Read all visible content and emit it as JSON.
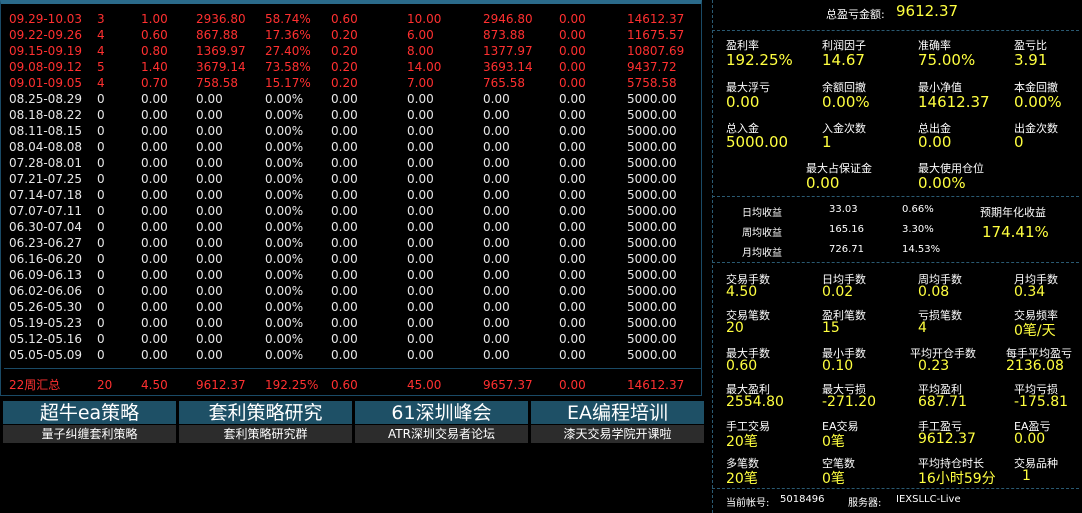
{
  "weekly_table": {
    "rows": [
      {
        "period": "09.29-10.03",
        "c1": "3",
        "c2": "1.00",
        "c3": "2936.80",
        "c4": "58.74%",
        "c5": "0.60",
        "c6": "10.00",
        "c7": "2946.80",
        "c8": "0.00",
        "c9": "14612.37",
        "highlight": true
      },
      {
        "period": "09.22-09.26",
        "c1": "4",
        "c2": "0.60",
        "c3": "867.88",
        "c4": "17.36%",
        "c5": "0.20",
        "c6": "6.00",
        "c7": "873.88",
        "c8": "0.00",
        "c9": "11675.57",
        "highlight": true
      },
      {
        "period": "09.15-09.19",
        "c1": "4",
        "c2": "0.80",
        "c3": "1369.97",
        "c4": "27.40%",
        "c5": "0.20",
        "c6": "8.00",
        "c7": "1377.97",
        "c8": "0.00",
        "c9": "10807.69",
        "highlight": true
      },
      {
        "period": "09.08-09.12",
        "c1": "5",
        "c2": "1.40",
        "c3": "3679.14",
        "c4": "73.58%",
        "c5": "0.20",
        "c6": "14.00",
        "c7": "3693.14",
        "c8": "0.00",
        "c9": "9437.72",
        "highlight": true
      },
      {
        "period": "09.01-09.05",
        "c1": "4",
        "c2": "0.70",
        "c3": "758.58",
        "c4": "15.17%",
        "c5": "0.20",
        "c6": "7.00",
        "c7": "765.58",
        "c8": "0.00",
        "c9": "5758.58",
        "highlight": true
      },
      {
        "period": "08.25-08.29",
        "c1": "0",
        "c2": "0.00",
        "c3": "0.00",
        "c4": "0.00%",
        "c5": "0.00",
        "c6": "0.00",
        "c7": "0.00",
        "c8": "0.00",
        "c9": "5000.00",
        "highlight": false
      },
      {
        "period": "08.18-08.22",
        "c1": "0",
        "c2": "0.00",
        "c3": "0.00",
        "c4": "0.00%",
        "c5": "0.00",
        "c6": "0.00",
        "c7": "0.00",
        "c8": "0.00",
        "c9": "5000.00",
        "highlight": false
      },
      {
        "period": "08.11-08.15",
        "c1": "0",
        "c2": "0.00",
        "c3": "0.00",
        "c4": "0.00%",
        "c5": "0.00",
        "c6": "0.00",
        "c7": "0.00",
        "c8": "0.00",
        "c9": "5000.00",
        "highlight": false
      },
      {
        "period": "08.04-08.08",
        "c1": "0",
        "c2": "0.00",
        "c3": "0.00",
        "c4": "0.00%",
        "c5": "0.00",
        "c6": "0.00",
        "c7": "0.00",
        "c8": "0.00",
        "c9": "5000.00",
        "highlight": false
      },
      {
        "period": "07.28-08.01",
        "c1": "0",
        "c2": "0.00",
        "c3": "0.00",
        "c4": "0.00%",
        "c5": "0.00",
        "c6": "0.00",
        "c7": "0.00",
        "c8": "0.00",
        "c9": "5000.00",
        "highlight": false
      },
      {
        "period": "07.21-07.25",
        "c1": "0",
        "c2": "0.00",
        "c3": "0.00",
        "c4": "0.00%",
        "c5": "0.00",
        "c6": "0.00",
        "c7": "0.00",
        "c8": "0.00",
        "c9": "5000.00",
        "highlight": false
      },
      {
        "period": "07.14-07.18",
        "c1": "0",
        "c2": "0.00",
        "c3": "0.00",
        "c4": "0.00%",
        "c5": "0.00",
        "c6": "0.00",
        "c7": "0.00",
        "c8": "0.00",
        "c9": "5000.00",
        "highlight": false
      },
      {
        "period": "07.07-07.11",
        "c1": "0",
        "c2": "0.00",
        "c3": "0.00",
        "c4": "0.00%",
        "c5": "0.00",
        "c6": "0.00",
        "c7": "0.00",
        "c8": "0.00",
        "c9": "5000.00",
        "highlight": false
      },
      {
        "period": "06.30-07.04",
        "c1": "0",
        "c2": "0.00",
        "c3": "0.00",
        "c4": "0.00%",
        "c5": "0.00",
        "c6": "0.00",
        "c7": "0.00",
        "c8": "0.00",
        "c9": "5000.00",
        "highlight": false
      },
      {
        "period": "06.23-06.27",
        "c1": "0",
        "c2": "0.00",
        "c3": "0.00",
        "c4": "0.00%",
        "c5": "0.00",
        "c6": "0.00",
        "c7": "0.00",
        "c8": "0.00",
        "c9": "5000.00",
        "highlight": false
      },
      {
        "period": "06.16-06.20",
        "c1": "0",
        "c2": "0.00",
        "c3": "0.00",
        "c4": "0.00%",
        "c5": "0.00",
        "c6": "0.00",
        "c7": "0.00",
        "c8": "0.00",
        "c9": "5000.00",
        "highlight": false
      },
      {
        "period": "06.09-06.13",
        "c1": "0",
        "c2": "0.00",
        "c3": "0.00",
        "c4": "0.00%",
        "c5": "0.00",
        "c6": "0.00",
        "c7": "0.00",
        "c8": "0.00",
        "c9": "5000.00",
        "highlight": false
      },
      {
        "period": "06.02-06.06",
        "c1": "0",
        "c2": "0.00",
        "c3": "0.00",
        "c4": "0.00%",
        "c5": "0.00",
        "c6": "0.00",
        "c7": "0.00",
        "c8": "0.00",
        "c9": "5000.00",
        "highlight": false
      },
      {
        "period": "05.26-05.30",
        "c1": "0",
        "c2": "0.00",
        "c3": "0.00",
        "c4": "0.00%",
        "c5": "0.00",
        "c6": "0.00",
        "c7": "0.00",
        "c8": "0.00",
        "c9": "5000.00",
        "highlight": false
      },
      {
        "period": "05.19-05.23",
        "c1": "0",
        "c2": "0.00",
        "c3": "0.00",
        "c4": "0.00%",
        "c5": "0.00",
        "c6": "0.00",
        "c7": "0.00",
        "c8": "0.00",
        "c9": "5000.00",
        "highlight": false
      },
      {
        "period": "05.12-05.16",
        "c1": "0",
        "c2": "0.00",
        "c3": "0.00",
        "c4": "0.00%",
        "c5": "0.00",
        "c6": "0.00",
        "c7": "0.00",
        "c8": "0.00",
        "c9": "5000.00",
        "highlight": false
      },
      {
        "period": "05.05-05.09",
        "c1": "0",
        "c2": "0.00",
        "c3": "0.00",
        "c4": "0.00%",
        "c5": "0.00",
        "c6": "0.00",
        "c7": "0.00",
        "c8": "0.00",
        "c9": "5000.00",
        "highlight": false
      }
    ],
    "summary": {
      "period": "22周汇总",
      "c1": "20",
      "c2": "4.50",
      "c3": "9612.37",
      "c4": "192.25%",
      "c5": "0.60",
      "c6": "45.00",
      "c7": "9657.37",
      "c8": "0.00",
      "c9": "14612.37"
    }
  },
  "promos": [
    {
      "title": "超牛ea策略",
      "subtitle": "量子纠缠套利策略"
    },
    {
      "title": "套利策略研究",
      "subtitle": "套利策略研究群"
    },
    {
      "title": "61深圳峰会",
      "subtitle": "ATR深圳交易者论坛"
    },
    {
      "title": "EA编程培训",
      "subtitle": "漆天交易学院开课啦"
    }
  ],
  "stats": {
    "total_pl_label": "总盈亏金额:",
    "total_pl_value": "9612.37",
    "profit_rate_label": "盈利率",
    "profit_rate": "192.25%",
    "profit_factor_label": "利润因子",
    "profit_factor": "14.67",
    "accuracy_label": "准确率",
    "accuracy": "75.00%",
    "pl_ratio_label": "盈亏比",
    "pl_ratio": "3.91",
    "max_float_loss_label": "最大浮亏",
    "max_float_loss": "0.00",
    "balance_drawdown_label": "余额回撤",
    "balance_drawdown": "0.00%",
    "min_equity_label": "最小净值",
    "min_equity": "14612.37",
    "principal_drawdown_label": "本金回撤",
    "principal_drawdown": "0.00%",
    "total_deposit_label": "总入金",
    "total_deposit": "5000.00",
    "deposit_count_label": "入金次数",
    "deposit_count": "1",
    "total_withdraw_label": "总出金",
    "total_withdraw": "0.00",
    "withdraw_count_label": "出金次数",
    "withdraw_count": "0",
    "max_margin_label": "最大占保证金",
    "max_margin": "0.00",
    "max_position_label": "最大使用仓位",
    "max_position": "0.00%",
    "daily_label": "日均收益",
    "daily_value": "33.03",
    "daily_pct": "0.66%",
    "weekly_label": "周均收益",
    "weekly_value": "165.16",
    "weekly_pct": "3.30%",
    "monthly_label": "月均收益",
    "monthly_value": "726.71",
    "monthly_pct": "14.53%",
    "annual_label": "预期年化收益",
    "annual_value": "174.41%",
    "lots_label": "交易手数",
    "lots": "4.50",
    "daily_lots_label": "日均手数",
    "daily_lots": "0.02",
    "weekly_lots_label": "周均手数",
    "weekly_lots": "0.08",
    "monthly_lots_label": "月均手数",
    "monthly_lots": "0.34",
    "trades_label": "交易笔数",
    "trades": "20",
    "win_trades_label": "盈利笔数",
    "win_trades": "15",
    "loss_trades_label": "亏损笔数",
    "loss_trades": "4",
    "freq_label": "交易频率",
    "freq": "0笔/天",
    "max_lots_label": "最大手数",
    "max_lots": "0.60",
    "min_lots_label": "最小手数",
    "min_lots": "0.10",
    "avg_open_lots_label": "平均开仓手数",
    "avg_open_lots": "0.23",
    "avg_pl_per_lot_label": "每手平均盈亏",
    "avg_pl_per_lot": "2136.08",
    "max_profit_label": "最大盈利",
    "max_profit": "2554.80",
    "max_loss_label": "最大亏损",
    "max_loss": "-271.20",
    "avg_profit_label": "平均盈利",
    "avg_profit": "687.71",
    "avg_loss_label": "平均亏损",
    "avg_loss": "-175.81",
    "manual_trades_label": "手工交易",
    "manual_trades": "20笔",
    "ea_trades_label": "EA交易",
    "ea_trades": "0笔",
    "manual_pl_label": "手工盈亏",
    "manual_pl": "9612.37",
    "ea_pl_label": "EA盈亏",
    "ea_pl": "0.00",
    "long_label": "多笔数",
    "long_count": "20笔",
    "short_label": "空笔数",
    "short_count": "0笔",
    "avg_hold_label": "平均持仓时长",
    "avg_hold": "16小时59分",
    "symbols_label": "交易品种",
    "symbols": "1",
    "account_label": "当前帐号:",
    "account": "5018496",
    "server_label": "服务器:",
    "server": "IEXSLLC-Live"
  }
}
